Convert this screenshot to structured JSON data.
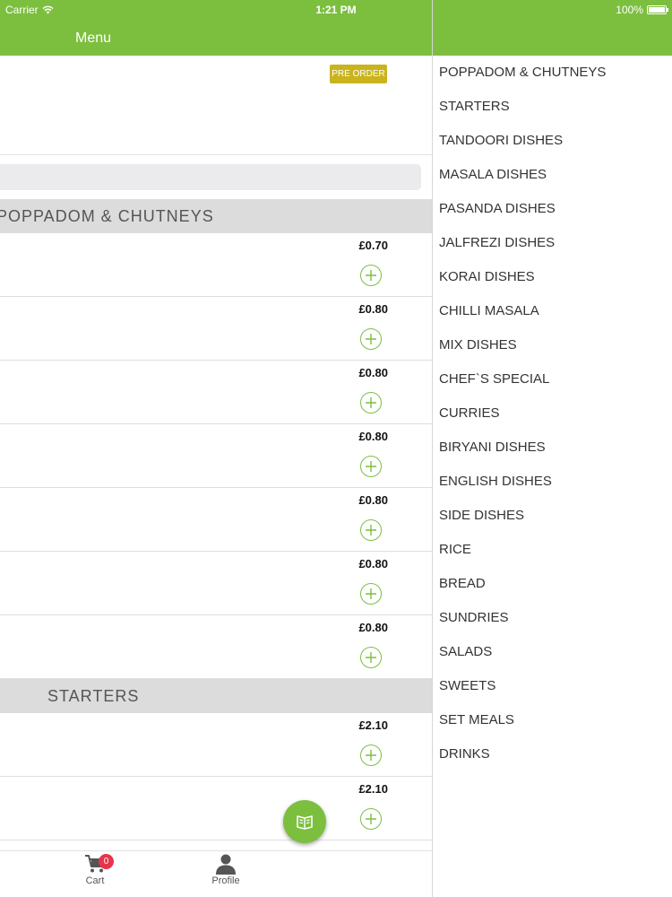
{
  "status_bar": {
    "carrier": "Carrier",
    "time": "1:21 PM",
    "battery": "100%"
  },
  "nav": {
    "title": "Menu"
  },
  "main": {
    "preorder_label": "PRE ORDER",
    "sections": [
      {
        "title": "POPPADOM & CHUTNEYS",
        "items": [
          {
            "price": "£0.70"
          },
          {
            "price": "£0.80"
          },
          {
            "price": "£0.80"
          },
          {
            "price": "£0.80"
          },
          {
            "price": "£0.80"
          },
          {
            "price": "£0.80"
          },
          {
            "price": "£0.80"
          }
        ]
      },
      {
        "title": "STARTERS",
        "items": [
          {
            "price": "£2.10"
          },
          {
            "price": "£2.10"
          }
        ]
      }
    ]
  },
  "tabbar": {
    "cart_label": "Cart",
    "cart_badge": "0",
    "profile_label": "Profile"
  },
  "categories": [
    "POPPADOM & CHUTNEYS",
    "STARTERS",
    "TANDOORI DISHES",
    "MASALA DISHES",
    "PASANDA DISHES",
    "JALFREZI DISHES",
    "KORAI DISHES",
    "CHILLI MASALA",
    "MIX DISHES",
    "CHEF`S SPECIAL",
    "CURRIES",
    "BIRYANI DISHES",
    "ENGLISH DISHES",
    "SIDE DISHES",
    "RICE",
    "BREAD",
    "SUNDRIES",
    "SALADS",
    "SWEETS",
    "SET MEALS",
    "DRINKS"
  ],
  "colors": {
    "brand_green": "#7cbf3f",
    "preorder_gold": "#c9b41e",
    "badge_red": "#e8344a"
  },
  "icons": {
    "add": "plus-circle-icon",
    "fab": "menu-book-icon",
    "cart": "cart-icon",
    "profile": "person-icon",
    "wifi": "wifi-icon",
    "battery": "battery-icon"
  }
}
